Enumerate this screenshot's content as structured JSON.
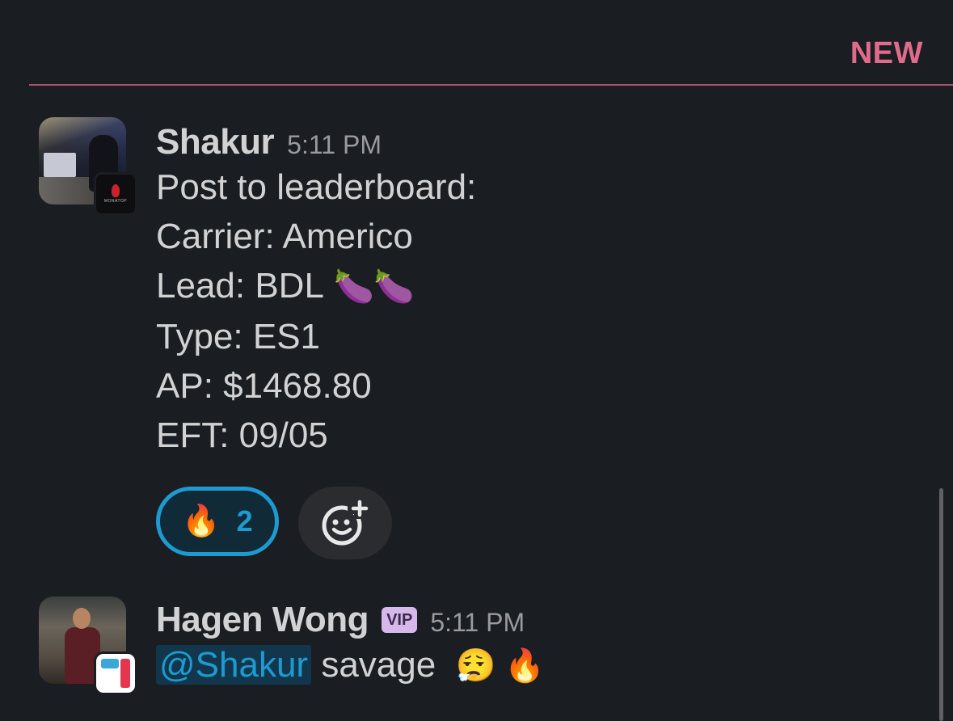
{
  "divider": {
    "label": "NEW"
  },
  "messages": [
    {
      "author": "Shakur",
      "time": "5:11 PM",
      "lines": [
        {
          "text": "Post to leaderboard:",
          "emoji": ""
        },
        {
          "text": "Carrier: Americo",
          "emoji": ""
        },
        {
          "text": "Lead: BDL",
          "emoji": "🍆🍆"
        },
        {
          "text": "Type: ES1",
          "emoji": ""
        },
        {
          "text": "AP: $1468.80",
          "emoji": ""
        },
        {
          "text": "EFT: 09/05",
          "emoji": ""
        }
      ],
      "reactions": [
        {
          "emoji": "🔥",
          "count": "2"
        }
      ]
    },
    {
      "author": "Hagen Wong",
      "badge": "VIP",
      "time": "5:11 PM",
      "mention": "@Shakur",
      "text": "savage",
      "emoji": "😮‍💨 🔥"
    }
  ],
  "colors": {
    "background": "#1a1d21",
    "new_divider": "#e06b8b",
    "reaction_accent": "#1d9bd1",
    "vip_badge": "#d6b8ec"
  },
  "icons": {
    "add_reaction": "add-reaction-icon"
  }
}
